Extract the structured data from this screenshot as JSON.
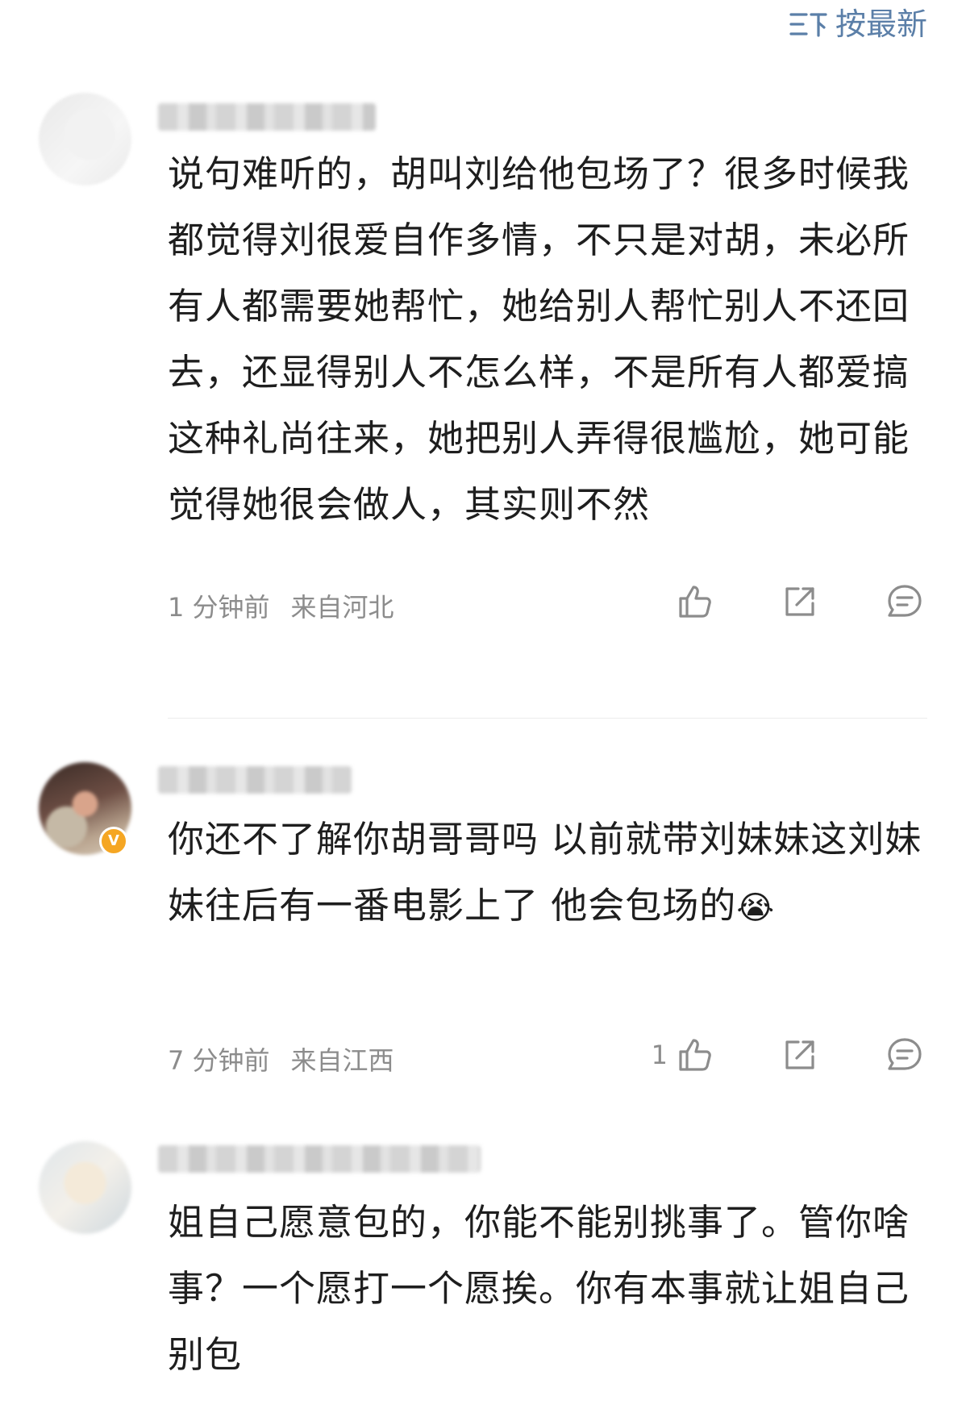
{
  "sort": {
    "label": "按最新",
    "icon": "sort-icon"
  },
  "comments": [
    {
      "username": "████████████",
      "verified": false,
      "text": "说句难听的，胡叫刘给他包场了？很多时候我都觉得刘很爱自作多情，不只是对胡，未必所有人都需要她帮忙，她给别人帮忙别人不还回去，还显得别人不怎么样，不是所有人都爱搞这种礼尚往来，她把别人弄得很尴尬，她可能觉得她很会做人，其实则不然",
      "time": "1 分钟前",
      "location": "来自河北",
      "likes": ""
    },
    {
      "username": "██████████",
      "verified": true,
      "text": "你还不了解你胡哥哥吗 以前就带刘妹妹这刘妹妹往后有一番电影上了 他会包场的",
      "emoji": "😭",
      "time": "7 分钟前",
      "location": "来自江西",
      "likes": "1"
    },
    {
      "username": "██████████████",
      "verified": false,
      "text": "姐自己愿意包的，你能不能别挑事了。管你啥事？一个愿打一个愿挨。你有本事就让姐自己别包",
      "time": "",
      "location": "",
      "likes": ""
    }
  ]
}
